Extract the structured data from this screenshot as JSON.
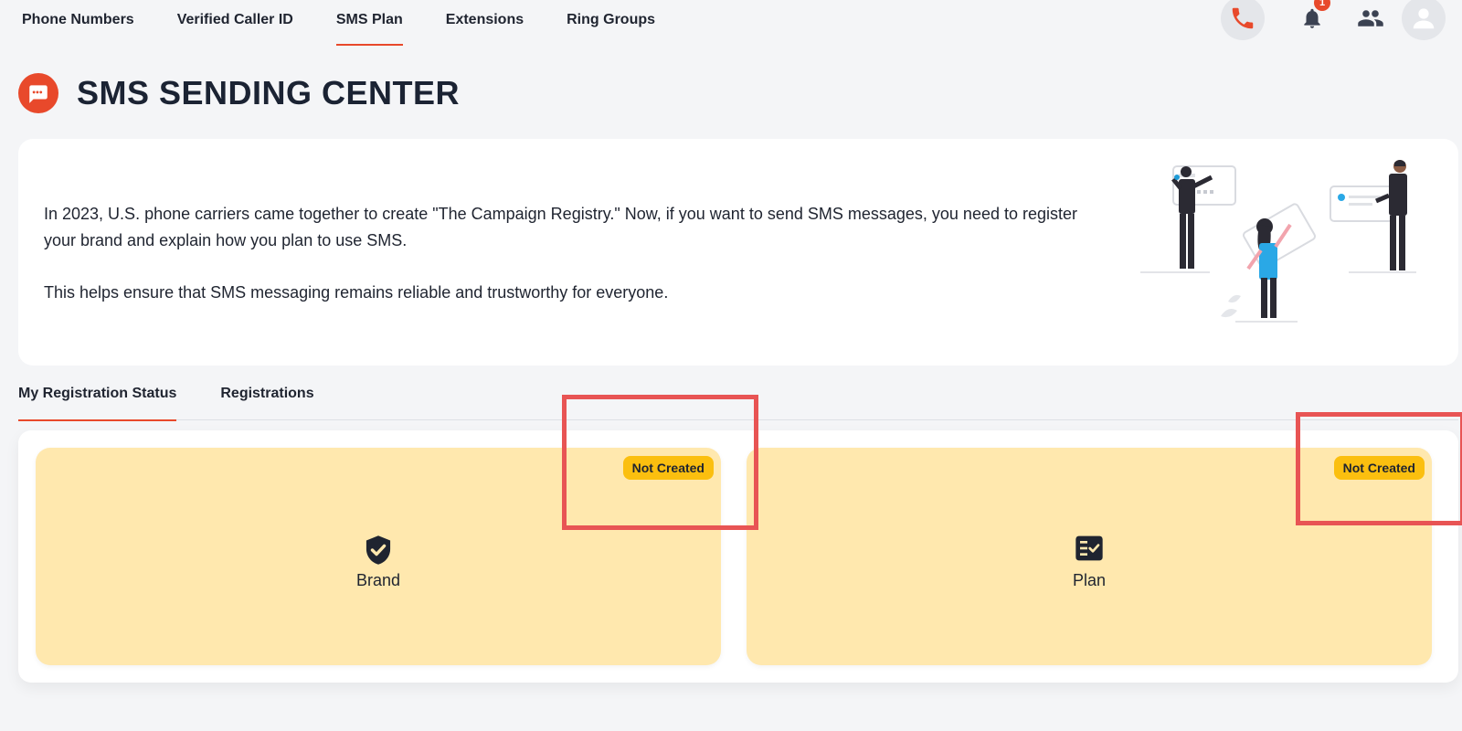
{
  "topnav": {
    "tabs": [
      {
        "label": "Phone Numbers",
        "active": false
      },
      {
        "label": "Verified Caller ID",
        "active": false
      },
      {
        "label": "SMS Plan",
        "active": true
      },
      {
        "label": "Extensions",
        "active": false
      },
      {
        "label": "Ring Groups",
        "active": false
      }
    ],
    "icons": [
      "phone-icon",
      "bell-icon",
      "users-icon",
      "user-avatar-icon"
    ],
    "notification_count": "1"
  },
  "header": {
    "title": "SMS SENDING CENTER",
    "icon": "sms-chat-icon"
  },
  "info": {
    "paragraph1": "In 2023, U.S. phone carriers came together to create \"The Campaign Registry.\" Now, if you want to send SMS messages, you need to register your brand and explain how you plan to use SMS.",
    "paragraph2": "This helps ensure that SMS messaging remains reliable and trustworthy for everyone."
  },
  "sub_tabs": [
    {
      "label": "My Registration Status",
      "active": true
    },
    {
      "label": "Registrations",
      "active": false
    }
  ],
  "cards": {
    "brand": {
      "label": "Brand",
      "status": "Not Created",
      "icon": "shield-check-icon"
    },
    "plan": {
      "label": "Plan",
      "status": "Not Created",
      "icon": "checklist-icon"
    }
  },
  "colors": {
    "accent": "#e8492b",
    "card_bg": "#ffe8ae",
    "badge_bg": "#fbbf0f",
    "annotation": "#e85454",
    "illustration_blue": "#2aa8e6"
  }
}
